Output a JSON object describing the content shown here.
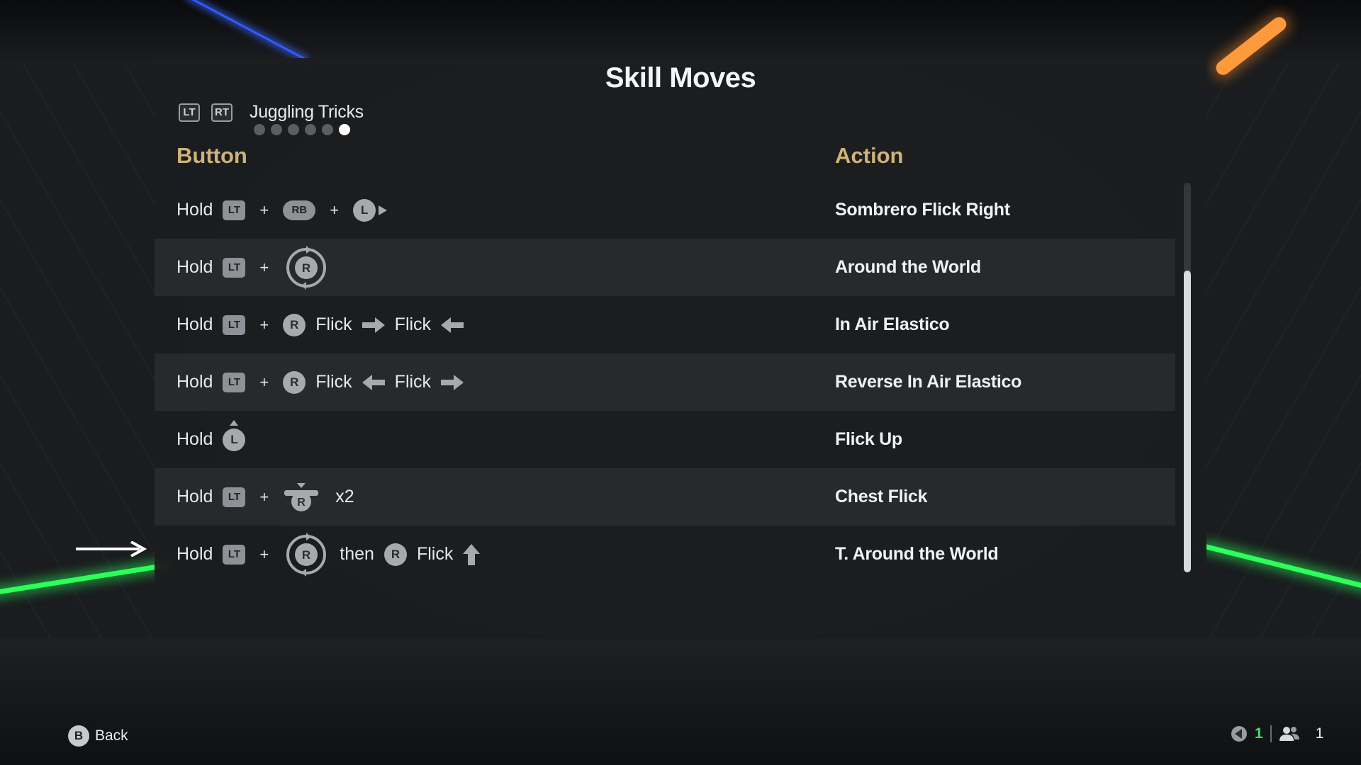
{
  "title": "Skill Moves",
  "category": {
    "lt": "LT",
    "rt": "RT",
    "label": "Juggling Tricks",
    "page_count": 6,
    "active_page": 6
  },
  "columns": {
    "button": "Button",
    "action": "Action"
  },
  "text": {
    "hold": "Hold",
    "plus": "+",
    "flick": "Flick",
    "then": "then",
    "x2": "x2"
  },
  "buttons": {
    "lt": "LT",
    "rb": "RB",
    "l": "L",
    "r": "R"
  },
  "rows": [
    {
      "action": "Sombrero Flick Right"
    },
    {
      "action": "Around the World"
    },
    {
      "action": "In Air Elastico"
    },
    {
      "action": "Reverse In Air Elastico"
    },
    {
      "action": "Flick Up"
    },
    {
      "action": "Chest Flick"
    },
    {
      "action": "T. Around the World"
    }
  ],
  "footer": {
    "b_button": "B",
    "back": "Back",
    "count_a": "1",
    "count_b": "1"
  },
  "colors": {
    "accent_gold": "#cfb27a",
    "green": "#3be06a",
    "panel": "#1b1d1f"
  },
  "icons": [
    "lt-icon",
    "rt-icon",
    "rb-icon",
    "l-stick-icon",
    "r-stick-icon",
    "rotate-stick-icon",
    "arrow-right-icon",
    "arrow-left-icon",
    "arrow-up-icon",
    "b-button-icon",
    "mic-icon",
    "players-icon"
  ]
}
